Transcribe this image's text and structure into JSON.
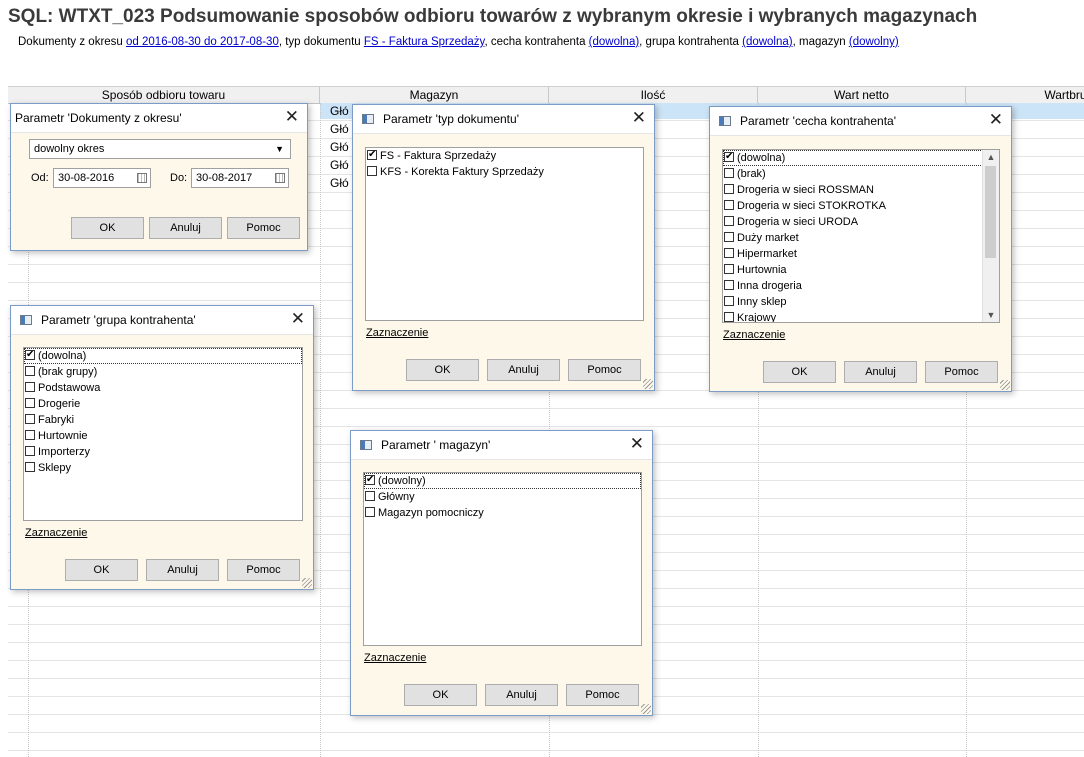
{
  "report": {
    "title": "SQL: WTXT_023 Podsumowanie sposobów odbioru towarów z wybranym okresie i wybranych magazynach",
    "subtitle": {
      "prefix1": "Dokumenty z okresu ",
      "link1": "od 2016-08-30 do 2017-08-30",
      "prefix2": ", typ dokumentu ",
      "link2": "FS - Faktura Sprzedaży",
      "prefix3": ", cecha kontrahenta ",
      "link3": "(dowolna)",
      "prefix4": ", grupa kontrahenta ",
      "link4": "(dowolna)",
      "prefix5": ", magazyn ",
      "link5": "(dowolny)"
    }
  },
  "grid": {
    "columns": [
      "Sposób odbioru towaru",
      "Magazyn",
      "Ilość",
      "Wart netto",
      "Wartbru"
    ],
    "visible_cells": [
      "Głó",
      "Głó",
      "Głó",
      "Głó",
      "Głó"
    ]
  },
  "dlg_okres": {
    "title": "Parametr 'Dokumenty z okresu'",
    "mode": "dowolny okres",
    "od_label": "Od:",
    "od_value": "30-08-2016",
    "do_label": "Do:",
    "do_value": "30-08-2017",
    "ok": "OK",
    "cancel": "Anuluj",
    "help": "Pomoc"
  },
  "dlg_typ": {
    "title": "Parametr 'typ dokumentu'",
    "items": [
      {
        "label": "FS - Faktura Sprzedaży",
        "checked": true
      },
      {
        "label": "KFS - Korekta Faktury Sprzedaży",
        "checked": false
      }
    ],
    "select_link": "Zaznaczenie",
    "ok": "OK",
    "cancel": "Anuluj",
    "help": "Pomoc"
  },
  "dlg_cecha": {
    "title": "Parametr 'cecha kontrahenta'",
    "items": [
      {
        "label": "(dowolna)",
        "checked": true
      },
      {
        "label": "(brak)",
        "checked": false
      },
      {
        "label": "Drogeria w sieci ROSSMAN",
        "checked": false
      },
      {
        "label": "Drogeria w sieci STOKROTKA",
        "checked": false
      },
      {
        "label": "Drogeria w sieci URODA",
        "checked": false
      },
      {
        "label": "Duży market",
        "checked": false
      },
      {
        "label": "Hipermarket",
        "checked": false
      },
      {
        "label": "Hurtownia",
        "checked": false
      },
      {
        "label": "Inna drogeria",
        "checked": false
      },
      {
        "label": "Inny sklep",
        "checked": false
      },
      {
        "label": "Krajowy",
        "checked": false
      }
    ],
    "select_link": "Zaznaczenie",
    "ok": "OK",
    "cancel": "Anuluj",
    "help": "Pomoc"
  },
  "dlg_grupa": {
    "title": "Parametr 'grupa kontrahenta'",
    "items": [
      {
        "label": "(dowolna)",
        "checked": true
      },
      {
        "label": "(brak grupy)",
        "checked": false
      },
      {
        "label": "Podstawowa",
        "checked": false
      },
      {
        "label": "Drogerie",
        "checked": false
      },
      {
        "label": "Fabryki",
        "checked": false
      },
      {
        "label": "Hurtownie",
        "checked": false
      },
      {
        "label": "Importerzy",
        "checked": false
      },
      {
        "label": "Sklepy",
        "checked": false
      }
    ],
    "select_link": "Zaznaczenie",
    "ok": "OK",
    "cancel": "Anuluj",
    "help": "Pomoc"
  },
  "dlg_magazyn": {
    "title": "Parametr ' magazyn'",
    "items": [
      {
        "label": "(dowolny)",
        "checked": true
      },
      {
        "label": "Główny",
        "checked": false
      },
      {
        "label": "Magazyn pomocniczy",
        "checked": false
      }
    ],
    "select_link": "Zaznaczenie",
    "ok": "OK",
    "cancel": "Anuluj",
    "help": "Pomoc"
  }
}
